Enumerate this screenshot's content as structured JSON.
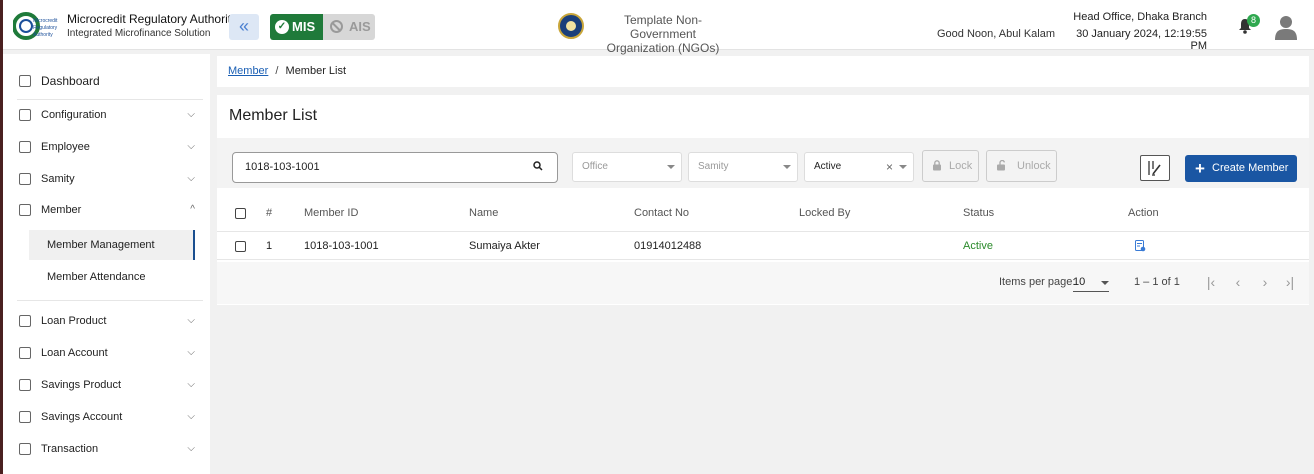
{
  "header": {
    "org_title": "Microcredit Regulatory Authority",
    "org_subtitle": "Integrated Microfinance Solution",
    "logo_text": [
      "Microcredit",
      "Regulatory",
      "Authority"
    ],
    "mis_label": "MIS",
    "ais_label": "AIS",
    "template_org_line1": "Template Non-Government",
    "template_org_line2": "Organization (NGOs)",
    "greeting": "Good Noon, Abul Kalam",
    "branch": "Head Office, Dhaka Branch",
    "datetime": "30 January 2024, 12:19:55 PM",
    "notification_count": "8"
  },
  "sidebar": {
    "dashboard": "Dashboard",
    "items": [
      {
        "label": "Configuration",
        "icon": "sliders-icon",
        "expanded": false
      },
      {
        "label": "Employee",
        "icon": "employee-icon",
        "expanded": false
      },
      {
        "label": "Samity",
        "icon": "group-icon",
        "expanded": false
      },
      {
        "label": "Member",
        "icon": "members-icon",
        "expanded": true
      },
      {
        "label": "Loan Product",
        "icon": "document-icon",
        "expanded": false
      },
      {
        "label": "Loan Account",
        "icon": "members-icon",
        "expanded": false
      },
      {
        "label": "Savings Product",
        "icon": "document-icon",
        "expanded": false
      },
      {
        "label": "Savings Account",
        "icon": "document-icon",
        "expanded": false
      },
      {
        "label": "Transaction",
        "icon": "document-icon",
        "expanded": false
      }
    ],
    "member_subitems": [
      {
        "label": "Member Management",
        "active": true
      },
      {
        "label": "Member Attendance",
        "active": false
      }
    ]
  },
  "breadcrumb": {
    "parent": "Member",
    "separator": "/",
    "current": "Member List"
  },
  "page": {
    "title": "Member List",
    "search_value": "1018-103-1001",
    "office_placeholder": "Office",
    "samity_placeholder": "Samity",
    "status_value": "Active",
    "lock_label": "Lock",
    "unlock_label": "Unlock",
    "create_label": "Create Member"
  },
  "table": {
    "headers": [
      "#",
      "Member ID",
      "Name",
      "Contact No",
      "Locked By",
      "Status",
      "Action"
    ],
    "rows": [
      {
        "index": "1",
        "member_id": "1018-103-1001",
        "name": "Sumaiya Akter",
        "contact": "01914012488",
        "locked_by": "",
        "status": "Active"
      }
    ]
  },
  "paginator": {
    "items_per_page_label": "Items per page:",
    "items_per_page": "10",
    "range": "1 – 1 of 1"
  },
  "colors": {
    "primary": "#1a56a3",
    "mis_green": "#1f7a3a",
    "status_active": "#2a8a2a"
  }
}
